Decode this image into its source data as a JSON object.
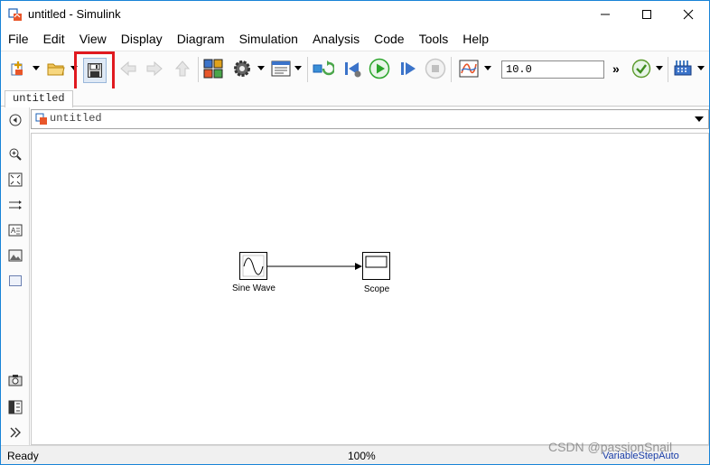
{
  "window": {
    "title": "untitled - Simulink"
  },
  "menu": [
    "File",
    "Edit",
    "View",
    "Display",
    "Diagram",
    "Simulation",
    "Analysis",
    "Code",
    "Tools",
    "Help"
  ],
  "toolbar": {
    "stop_time": "10.0",
    "more": "»"
  },
  "tabs": [
    {
      "label": "untitled"
    }
  ],
  "address": {
    "path": "untitled"
  },
  "blocks": {
    "sine": {
      "label": "Sine Wave"
    },
    "scope": {
      "label": "Scope"
    }
  },
  "status": {
    "state": "Ready",
    "zoom": "100%",
    "solver": "VariableStepAuto"
  },
  "watermark": "CSDN @passionSnail",
  "colors": {
    "accent": "#1883d7",
    "highlight": "#e0191f",
    "run_green": "#2aa52a",
    "solver_text": "#1a3ea8"
  }
}
